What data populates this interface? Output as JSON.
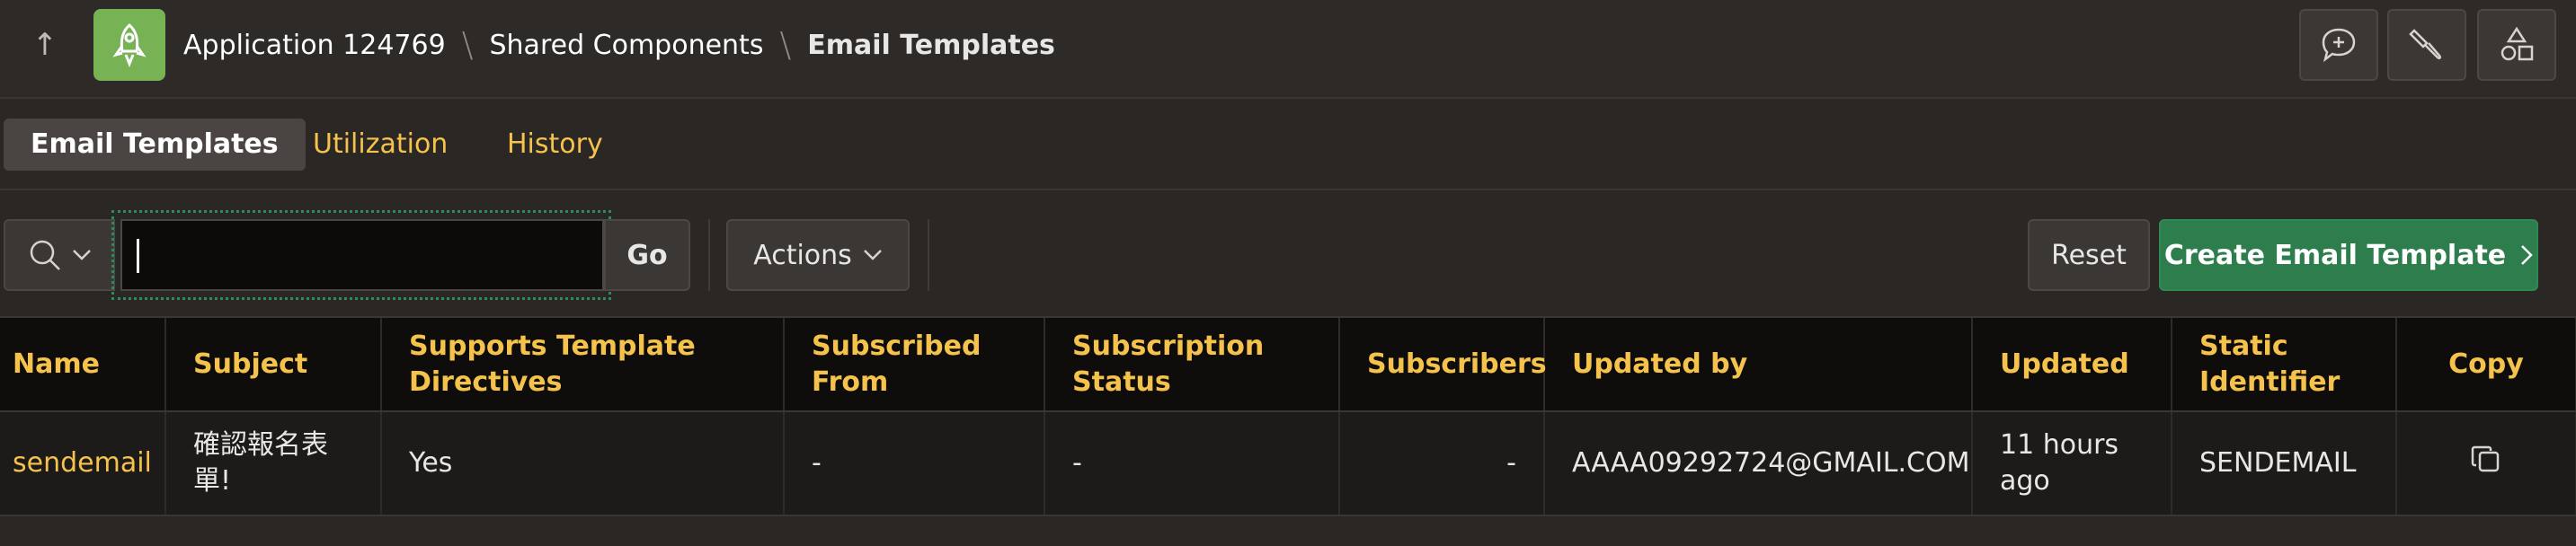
{
  "header": {
    "breadcrumb": [
      "Application 124769",
      "Shared Components",
      "Email Templates"
    ],
    "icons": {
      "up": "arrow-up-icon",
      "app": "rocket-icon",
      "feedback": "chat-plus-icon",
      "developer": "brush-icon",
      "shapes": "shapes-icon"
    }
  },
  "tabs": [
    {
      "label": "Email Templates",
      "active": true
    },
    {
      "label": "Utilization",
      "active": false
    },
    {
      "label": "History",
      "active": false
    }
  ],
  "toolbar": {
    "search_value": "",
    "go_label": "Go",
    "actions_label": "Actions",
    "reset_label": "Reset",
    "create_label": "Create Email Template"
  },
  "table": {
    "columns": [
      "Name",
      "Subject",
      "Supports Template Directives",
      "Subscribed From",
      "Subscription Status",
      "Subscribers",
      "Updated by",
      "Updated",
      "Static Identifier",
      "Copy"
    ],
    "rows": [
      {
        "name": "sendemail",
        "subject": "確認報名表單!",
        "supports_directives": "Yes",
        "subscribed_from": "-",
        "subscription_status": "-",
        "subscribers": "-",
        "updated_by": "AAAA09292724@GMAIL.COM",
        "updated": "11 hours ago",
        "static_identifier": "SENDEMAIL"
      }
    ]
  },
  "colors": {
    "accent": "#f5c34c",
    "primary_button": "#2e7d4d",
    "app_icon": "#77b255"
  }
}
